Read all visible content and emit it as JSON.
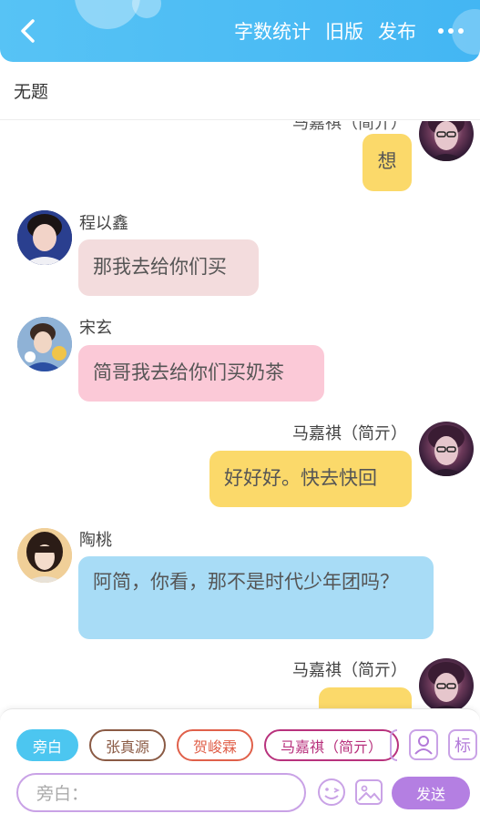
{
  "header": {
    "word_count_label": "字数统计",
    "old_version_label": "旧版",
    "publish_label": "发布"
  },
  "title": "无题",
  "messages": [
    {
      "side": "right",
      "name": "马嘉祺（简亓）",
      "text": "想",
      "color": "#fbd96a"
    },
    {
      "side": "left",
      "name": "程以鑫",
      "text": "那我去给你们买",
      "color": "#f3dcdd"
    },
    {
      "side": "left",
      "name": "宋玄",
      "text": "简哥我去给你们买奶茶",
      "color": "#fbc9d7"
    },
    {
      "side": "right",
      "name": "马嘉祺（简亓）",
      "text": "好好好。快去快回",
      "color": "#fbd96a"
    },
    {
      "side": "left",
      "name": "陶桃",
      "text": "阿简，你看，那不是时代少年团吗？",
      "color": "#a8dcf6"
    },
    {
      "side": "right",
      "name": "马嘉祺（简亓）",
      "text": "",
      "color": "#fbd96a"
    }
  ],
  "chips": [
    {
      "label": "旁白",
      "active": true,
      "color": "#4cc6f0"
    },
    {
      "label": "张真源",
      "active": false,
      "color": "#8a5a44"
    },
    {
      "label": "贺峻霖",
      "active": false,
      "color": "#e0604a"
    },
    {
      "label": "马嘉祺（简亓）",
      "active": false,
      "color": "#b8327d"
    }
  ],
  "tag_button_label": "标",
  "input": {
    "placeholder": "旁白："
  },
  "send_label": "发送",
  "accent_color": "#43b6f3"
}
